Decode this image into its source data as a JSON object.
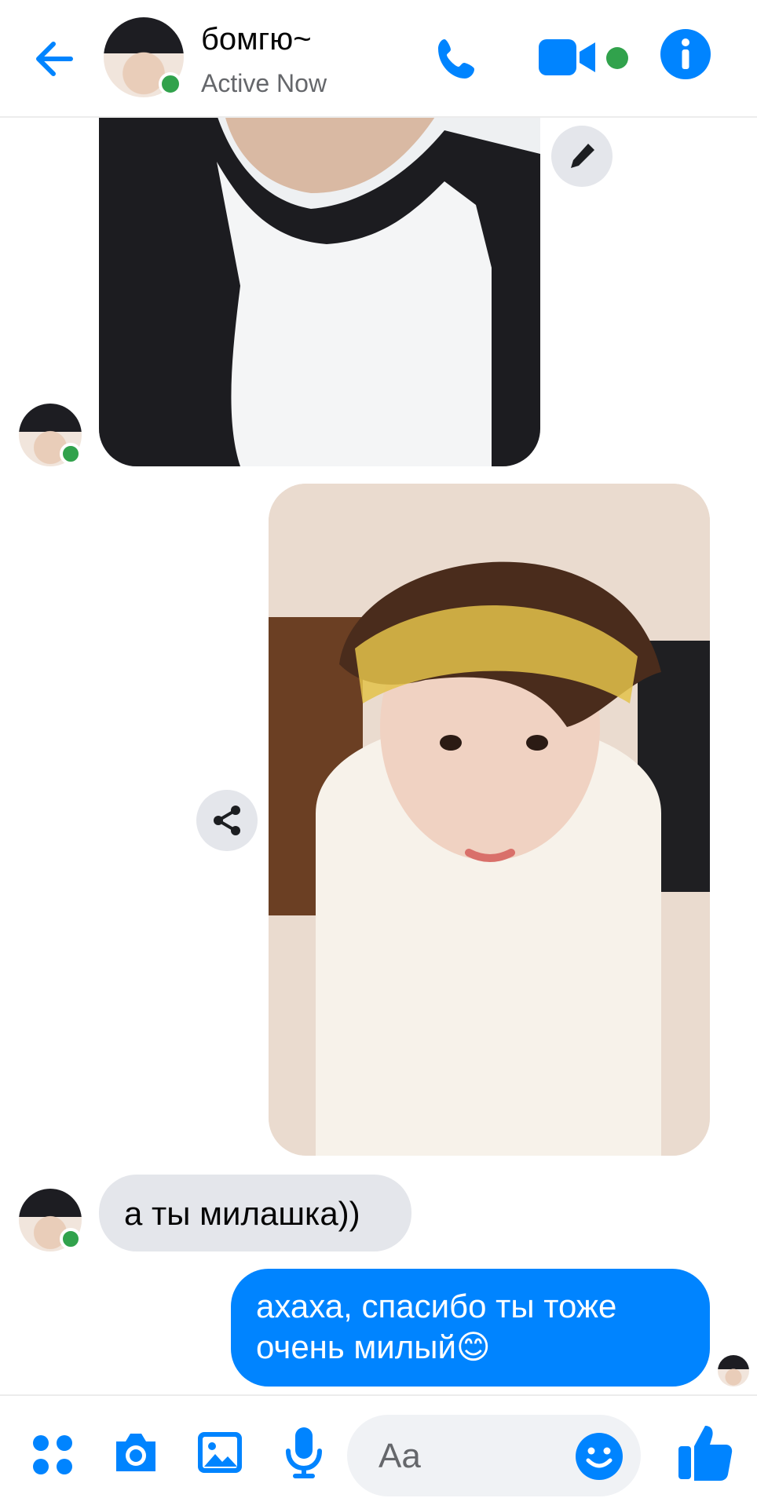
{
  "header": {
    "contact_name": "бомгю~",
    "status_text": "Active Now"
  },
  "messages": {
    "incoming_text": "а ты милашка))",
    "outgoing_line1": "ахаха, спасибо ты тоже",
    "outgoing_line2": "очень милый",
    "outgoing_emoji": "😊"
  },
  "composer": {
    "placeholder": "Aa"
  },
  "colors": {
    "accent": "#0084ff",
    "active_dot": "#31a24c",
    "incoming_bubble": "#e4e6eb"
  },
  "icons": {
    "back": "arrow-left-icon",
    "call": "phone-icon",
    "video": "video-camera-icon",
    "info": "info-icon",
    "edit": "pencil-icon",
    "share": "share-icon",
    "menu": "four-dots-icon",
    "camera": "camera-icon",
    "gallery": "image-icon",
    "mic": "microphone-icon",
    "emoji": "smiley-icon",
    "like": "thumbs-up-icon"
  }
}
